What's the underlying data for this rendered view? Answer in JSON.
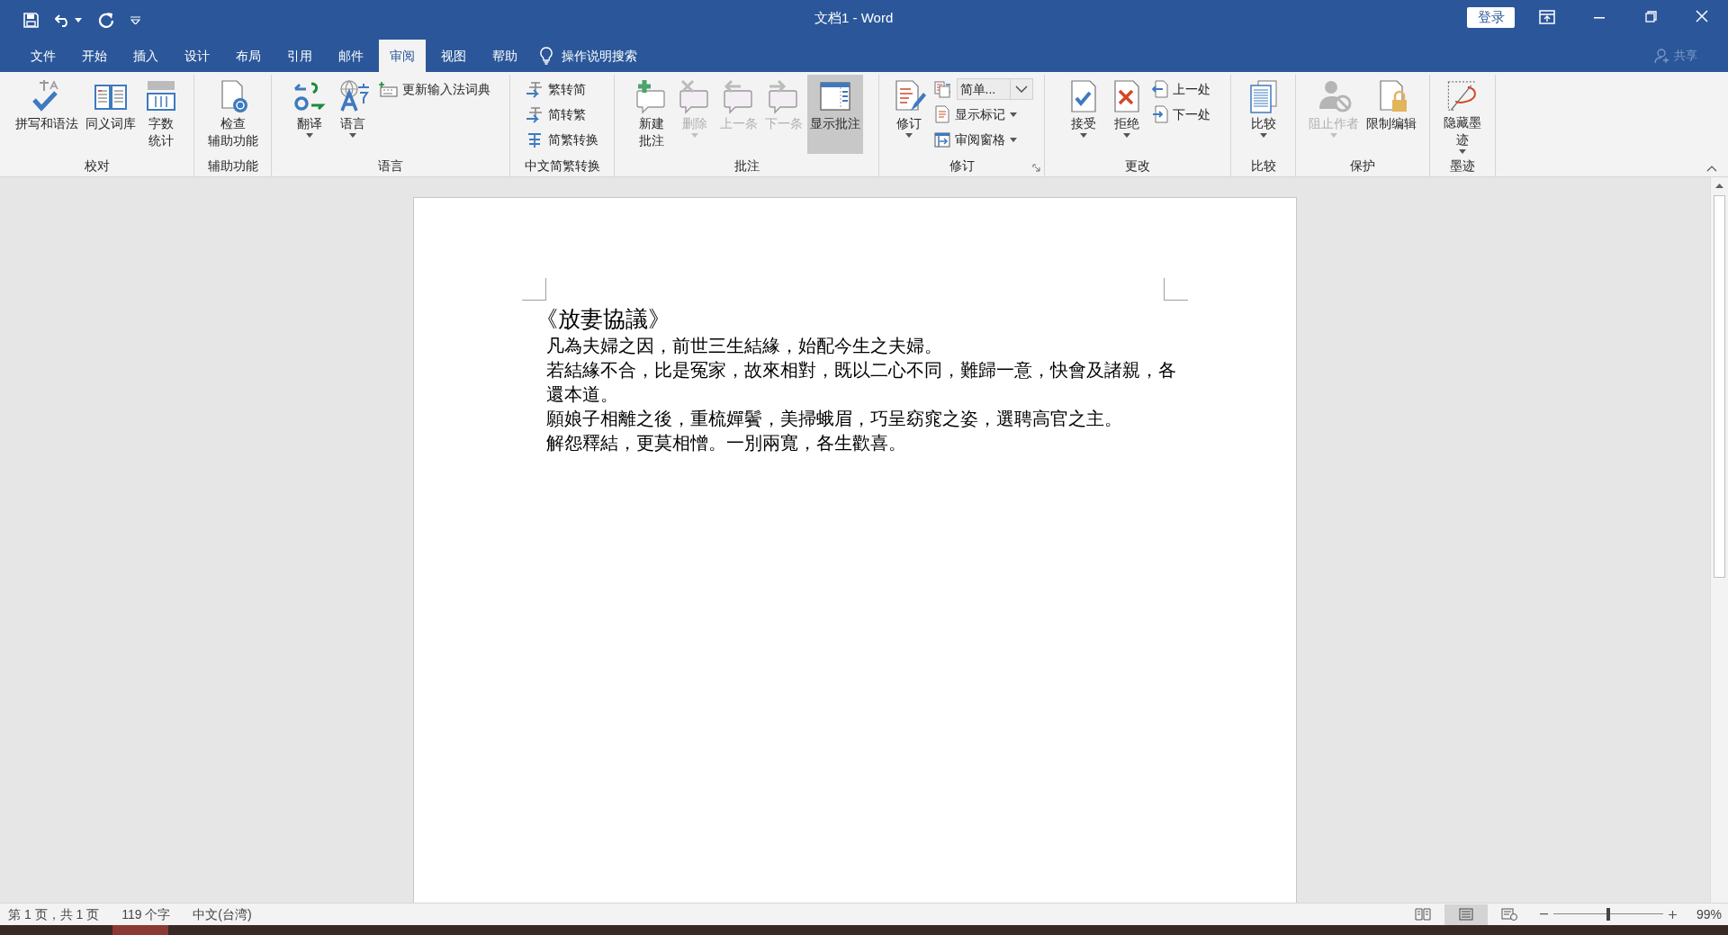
{
  "window": {
    "title": "文档1 - Word",
    "sign_in": "登录"
  },
  "tabs": [
    {
      "label": "文件",
      "selected": false
    },
    {
      "label": "开始",
      "selected": false
    },
    {
      "label": "插入",
      "selected": false
    },
    {
      "label": "设计",
      "selected": false
    },
    {
      "label": "布局",
      "selected": false
    },
    {
      "label": "引用",
      "selected": false
    },
    {
      "label": "邮件",
      "selected": false
    },
    {
      "label": "审阅",
      "selected": true
    },
    {
      "label": "视图",
      "selected": false
    },
    {
      "label": "帮助",
      "selected": false
    }
  ],
  "tell_me": {
    "label": "操作说明搜索"
  },
  "share": {
    "label": "共享",
    "disabled": true
  },
  "ribbon_groups": [
    {
      "label": "校对",
      "items": [
        {
          "kind": "large",
          "label": "拼写和语法",
          "disabled": false,
          "selected": false
        },
        {
          "kind": "large",
          "label": "同义词库",
          "disabled": false,
          "selected": false
        },
        {
          "kind": "large",
          "lines": [
            "字数",
            "统计"
          ],
          "disabled": false,
          "selected": false
        }
      ]
    },
    {
      "label": "辅助功能",
      "items": [
        {
          "kind": "large",
          "lines": [
            "检查",
            "辅助功能"
          ],
          "disabled": false,
          "selected": false
        }
      ]
    },
    {
      "label": "语言",
      "items": [
        {
          "kind": "large",
          "label": "翻译",
          "dropdown": true,
          "disabled": false,
          "selected": false
        },
        {
          "kind": "large",
          "label": "语言",
          "dropdown": true,
          "disabled": false,
          "selected": false
        },
        {
          "kind": "small",
          "label": "更新输入法词典",
          "disabled": false,
          "selected": false
        }
      ]
    },
    {
      "label": "中文简繁转换",
      "items": [
        {
          "kind": "small",
          "label": "繁转简",
          "disabled": false,
          "selected": false
        },
        {
          "kind": "small",
          "label": "简转繁",
          "disabled": false,
          "selected": false
        },
        {
          "kind": "small",
          "label": "简繁转换",
          "disabled": false,
          "selected": false
        }
      ]
    },
    {
      "label": "批注",
      "items": [
        {
          "kind": "large",
          "lines": [
            "新建",
            "批注"
          ],
          "disabled": false,
          "selected": false
        },
        {
          "kind": "large",
          "label": "删除",
          "dropdown": true,
          "disabled": true,
          "selected": false
        },
        {
          "kind": "large",
          "label": "上一条",
          "disabled": true,
          "selected": false
        },
        {
          "kind": "large",
          "label": "下一条",
          "disabled": true,
          "selected": false
        },
        {
          "kind": "large",
          "label": "显示批注",
          "disabled": false,
          "selected": true
        }
      ]
    },
    {
      "label": "修订",
      "launcher": true,
      "items": [
        {
          "kind": "large",
          "label": "修订",
          "dropdown": true,
          "disabled": false,
          "selected": false
        },
        {
          "kind": "combo",
          "label": "简单...",
          "disabled": false,
          "selected": false
        },
        {
          "kind": "small",
          "label": "显示标记",
          "dropdown": true,
          "disabled": false,
          "selected": false
        },
        {
          "kind": "small",
          "label": "审阅窗格",
          "dropdown": true,
          "disabled": false,
          "selected": false
        }
      ]
    },
    {
      "label": "更改",
      "items": [
        {
          "kind": "large",
          "label": "接受",
          "dropdown": true,
          "disabled": false,
          "selected": false
        },
        {
          "kind": "large",
          "label": "拒绝",
          "dropdown": true,
          "disabled": false,
          "selected": false
        },
        {
          "kind": "small",
          "label": "上一处",
          "disabled": false,
          "selected": false
        },
        {
          "kind": "small",
          "label": "下一处",
          "disabled": false,
          "selected": false
        }
      ]
    },
    {
      "label": "比较",
      "items": [
        {
          "kind": "large",
          "label": "比较",
          "dropdown": true,
          "disabled": false,
          "selected": false
        }
      ]
    },
    {
      "label": "保护",
      "items": [
        {
          "kind": "large",
          "label": "阻止作者",
          "dropdown": true,
          "disabled": true,
          "selected": false
        },
        {
          "kind": "large",
          "label": "限制编辑",
          "disabled": false,
          "selected": false
        }
      ]
    },
    {
      "label": "墨迹",
      "items": [
        {
          "kind": "large",
          "lines": [
            "隐藏墨",
            "迹"
          ],
          "dropdown": true,
          "disabled": false,
          "selected": false
        }
      ]
    }
  ],
  "document": {
    "title": "《放妻協議》",
    "paragraphs": [
      "凡為夫婦之因，前世三生結緣，始配今生之夫婦。",
      "若結緣不合，比是冤家，故來相對，既以二心不同，難歸一意，快會及諸親，各還本道。",
      "願娘子相離之後，重梳嬋鬢，美掃蛾眉，巧呈窈窕之姿，選聘高官之主。",
      "解怨釋結，更莫相憎。一別兩寬，各生歡喜。"
    ]
  },
  "status_bar": {
    "page": "第 1 页，共 1 页",
    "words": "119 个字",
    "language": "中文(台湾)",
    "views": [
      {
        "kind": "read",
        "selected": false
      },
      {
        "kind": "print",
        "selected": true
      },
      {
        "kind": "web",
        "selected": false
      }
    ],
    "zoom": {
      "level": 0.5,
      "reading": "99%"
    }
  }
}
